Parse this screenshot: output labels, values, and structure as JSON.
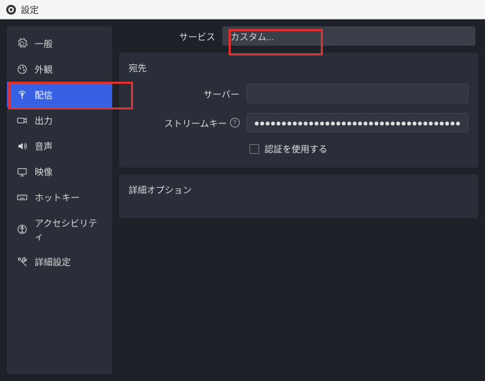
{
  "window": {
    "title": "設定"
  },
  "sidebar": {
    "items": [
      {
        "label": "一般"
      },
      {
        "label": "外観"
      },
      {
        "label": "配信"
      },
      {
        "label": "出力"
      },
      {
        "label": "音声"
      },
      {
        "label": "映像"
      },
      {
        "label": "ホットキー"
      },
      {
        "label": "アクセシビリティ"
      },
      {
        "label": "詳細設定"
      }
    ],
    "active_index": 2
  },
  "service": {
    "label": "サービス",
    "value": "カスタム..."
  },
  "destination": {
    "heading": "宛先",
    "server_label": "サーバー",
    "server_value": "",
    "streamkey_label": "ストリームキー",
    "streamkey_value": "●●●●●●●●●●●●●●●●●●●●●●●●●●●●●●●●●●●●●●",
    "auth_checkbox_label": "認証を使用する",
    "auth_checked": false
  },
  "advanced": {
    "heading": "詳細オプション"
  }
}
